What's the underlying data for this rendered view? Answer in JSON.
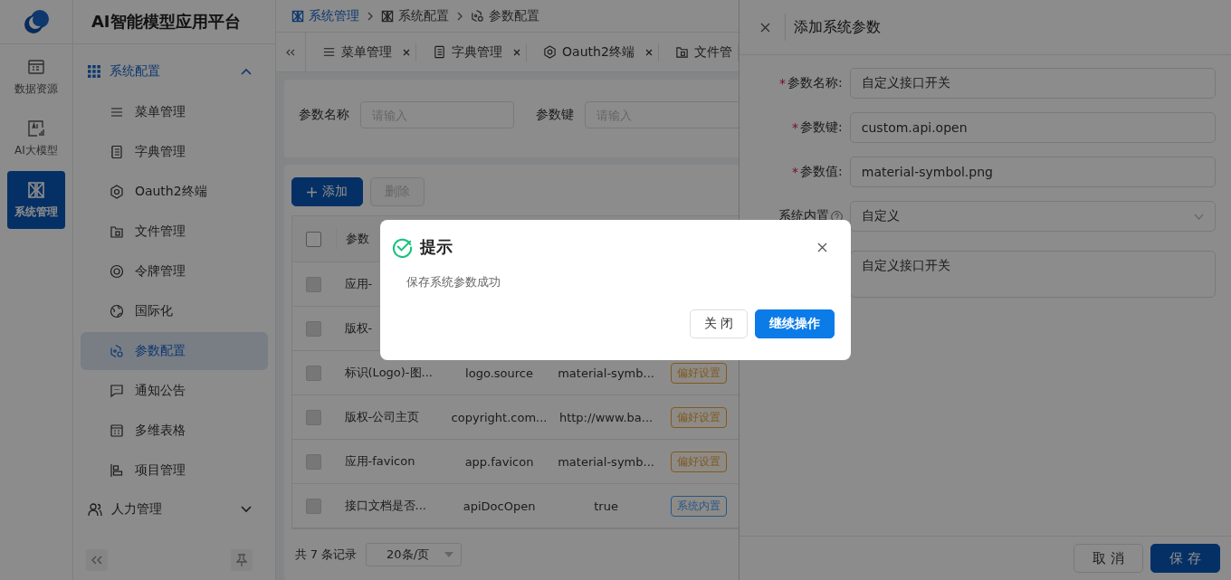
{
  "app": {
    "title": "AI智能模型应用平台"
  },
  "rail": [
    {
      "label": "数据资源",
      "selected": false
    },
    {
      "label": "AI大模型",
      "selected": false
    },
    {
      "label": "系统管理",
      "selected": true
    }
  ],
  "menu": [
    {
      "label": "系统配置",
      "expanded": true,
      "children": [
        {
          "label": "菜单管理",
          "selected": false
        },
        {
          "label": "字典管理",
          "selected": false
        },
        {
          "label": "Oauth2终端",
          "selected": false
        },
        {
          "label": "文件管理",
          "selected": false
        },
        {
          "label": "令牌管理",
          "selected": false
        },
        {
          "label": "国际化",
          "selected": false
        },
        {
          "label": "参数配置",
          "selected": true
        },
        {
          "label": "通知公告",
          "selected": false
        },
        {
          "label": "多维表格",
          "selected": false
        },
        {
          "label": "项目管理",
          "selected": false
        }
      ]
    },
    {
      "label": "人力管理",
      "expanded": false
    }
  ],
  "breadcrumb": [
    "系统管理",
    "系统配置",
    "参数配置"
  ],
  "tabs": [
    {
      "label": "菜单管理",
      "selected": false
    },
    {
      "label": "字典管理",
      "selected": false
    },
    {
      "label": "Oauth2终端",
      "selected": false
    },
    {
      "label": "文件管",
      "selected": false
    }
  ],
  "search": [
    {
      "label": "参数名称",
      "placeholder": "请输入"
    },
    {
      "label": "参数键",
      "placeholder": "请输入"
    }
  ],
  "toolbar": {
    "add": "添加",
    "delete": "删除",
    "delete_disabled": true
  },
  "table": {
    "columns": [
      "参数"
    ],
    "all_checked": false,
    "rows": [
      {
        "checked": false,
        "cells": [
          "应用-"
        ]
      },
      {
        "checked": false,
        "cells": [
          "版权-"
        ]
      },
      {
        "checked": false,
        "cells": [
          "标识(Logo)-图...",
          "logo.source",
          "material-symb..."
        ],
        "tag": {
          "label": "偏好设置",
          "color": "#7e5921"
        }
      },
      {
        "checked": false,
        "cells": [
          "版权-公司主页",
          "copyright.com...",
          "http://www.ba..."
        ],
        "tag": {
          "label": "偏好设置",
          "color": "#7e5921"
        }
      },
      {
        "checked": false,
        "cells": [
          "应用-favicon",
          "app.favicon",
          "material-symb..."
        ],
        "tag": {
          "label": "偏好设置",
          "color": "#7e5921"
        }
      },
      {
        "checked": false,
        "cells": [
          "接口文档是否...",
          "apiDocOpen",
          "true"
        ],
        "tag": {
          "label": "系统内置",
          "color": "#23578c"
        }
      }
    ]
  },
  "pager": {
    "total": "共 7 条记录",
    "page_size": "20条/页"
  },
  "drawer": {
    "title": "添加系统参数",
    "fields": [
      {
        "kind": "input",
        "required": "*",
        "label": "参数名称:",
        "value": "自定义接口开关"
      },
      {
        "kind": "input",
        "required": "*",
        "label": "参数键:",
        "value": "custom.api.open"
      },
      {
        "kind": "input",
        "required": "*",
        "label": "参数值:",
        "value": "material-symbol.png"
      },
      {
        "kind": "select",
        "label": "系统内置",
        "help": true,
        "value": "自定义"
      },
      {
        "kind": "textarea",
        "value": "自定义接口开关"
      }
    ],
    "buttons": [
      {
        "label": "取 消",
        "primary": false
      },
      {
        "label": "保 存",
        "primary": true
      }
    ]
  },
  "modal": {
    "title": "提示",
    "message": "保存系统参数成功",
    "buttons": [
      {
        "label": "关 闭",
        "primary": false
      },
      {
        "label": "继续操作",
        "primary": true
      }
    ]
  }
}
